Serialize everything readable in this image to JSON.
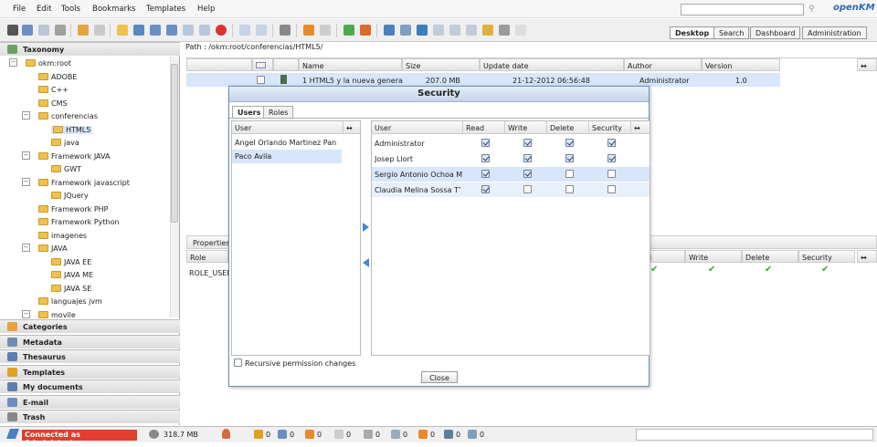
{
  "menu": [
    "File",
    "Edit",
    "Tools",
    "Bookmarks",
    "Templates",
    "Help"
  ],
  "logo": "openKM",
  "top_tabs": [
    "Desktop",
    "Search",
    "Dashboard",
    "Administration"
  ],
  "nav": {
    "taxonomy": "Taxonomy",
    "tree": [
      {
        "label": "okm:root",
        "toggle": "⊟"
      },
      {
        "label": "ADOBE"
      },
      {
        "label": "C++"
      },
      {
        "label": "CMS"
      },
      {
        "label": "conferencias",
        "toggle": "⊟"
      },
      {
        "label": "HTML5"
      },
      {
        "label": "java"
      },
      {
        "label": "Framework JAVA",
        "toggle": "⊟"
      },
      {
        "label": "GWT"
      },
      {
        "label": "Framework javascript",
        "toggle": "⊟"
      },
      {
        "label": "JQuery"
      },
      {
        "label": "Framework PHP"
      },
      {
        "label": "Framework Python"
      },
      {
        "label": "imagenes"
      },
      {
        "label": "JAVA",
        "toggle": "⊟"
      },
      {
        "label": "JAVA EE"
      },
      {
        "label": "JAVA ME"
      },
      {
        "label": "JAVA SE"
      },
      {
        "label": "languajes jvm"
      },
      {
        "label": "movile",
        "toggle": "⊟"
      }
    ],
    "panels": [
      "Categories",
      "Metadata",
      "Thesaurus",
      "Templates",
      "My documents",
      "E-mail",
      "Trash"
    ]
  },
  "path": "Path : /okm:root/conferencias/HTML5/",
  "file_table": {
    "headers": [
      "Name",
      "Size",
      "Update date",
      "Author",
      "Version"
    ],
    "row": {
      "name": "1 HTML5 y la nueva genera",
      "size": "207.0 MB",
      "date": "21-12-2012 06:56:48",
      "author": "Administrator",
      "version": "1.0"
    }
  },
  "properties": {
    "tab": "Properties",
    "headers": [
      "Role",
      "d",
      "Write",
      "Delete",
      "Security"
    ],
    "row": "ROLE_USEI"
  },
  "dialog": {
    "title": "Security",
    "tabs": [
      "Users",
      "Roles"
    ],
    "left_header": "User",
    "left_users": [
      "Angel Orlando Martinez Pan",
      "Paco Avila"
    ],
    "right_headers": [
      "User",
      "Read",
      "Write",
      "Delete",
      "Security"
    ],
    "right_rows": [
      {
        "user": "Administrator",
        "read": true,
        "write": true,
        "delete": true,
        "security": true
      },
      {
        "user": "Josep Llort",
        "read": true,
        "write": true,
        "delete": true,
        "security": true
      },
      {
        "user": "Sergio Antonio Ochoa M",
        "read": true,
        "write": true,
        "delete": false,
        "security": false
      },
      {
        "user": "Claudia Melina Sossa T’",
        "read": true,
        "write": false,
        "delete": false,
        "security": false
      }
    ],
    "recursive": "Recursive permission changes",
    "close": "Close"
  },
  "status": {
    "connected": "Connected as Administrator",
    "size": "318.7 MB",
    "counts": [
      "0",
      "0",
      "0",
      "0",
      "0",
      "0",
      "0",
      "0",
      "0"
    ]
  },
  "colors": {
    "accent": "#2f6bb0",
    "selected": "#d7e6fa",
    "status_red": "#e23d2d"
  }
}
